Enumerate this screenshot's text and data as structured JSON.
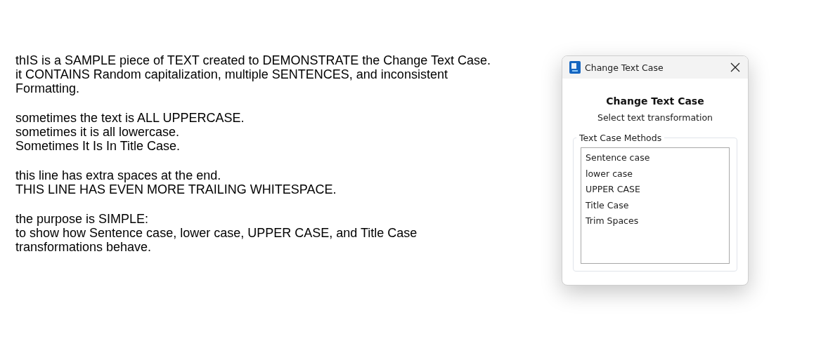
{
  "document": {
    "paragraphs": [
      {
        "lines": [
          "thIS is a SAMPLE piece of TEXT created to DEMONSTRATE the Change Text Case.",
          "it CONTAINS Random capitalization, multiple SENTENCES, and inconsistent",
          "Formatting."
        ]
      },
      {
        "lines": [
          "sometimes the text is ALL UPPERCASE.",
          "sometimes it is all lowercase.",
          "Sometimes It Is In Title Case."
        ]
      },
      {
        "lines": [
          "this line has extra spaces at the end.",
          "THIS LINE HAS EVEN MORE TRAILING WHITESPACE."
        ]
      },
      {
        "lines": [
          "the purpose is SIMPLE:",
          "to show how Sentence case, lower case, UPPER CASE, and Title Case",
          "transformations behave."
        ]
      }
    ]
  },
  "dialog": {
    "title": "Change Text Case",
    "heading": "Change Text Case",
    "subtitle": "Select text transformation",
    "group_label": "Text Case Methods",
    "methods": [
      {
        "label": "Sentence case",
        "selected": false
      },
      {
        "label": "lower case",
        "selected": false
      },
      {
        "label": "UPPER CASE",
        "selected": false
      },
      {
        "label": "Title Case",
        "selected": false
      },
      {
        "label": "Trim Spaces",
        "selected": false
      }
    ]
  }
}
